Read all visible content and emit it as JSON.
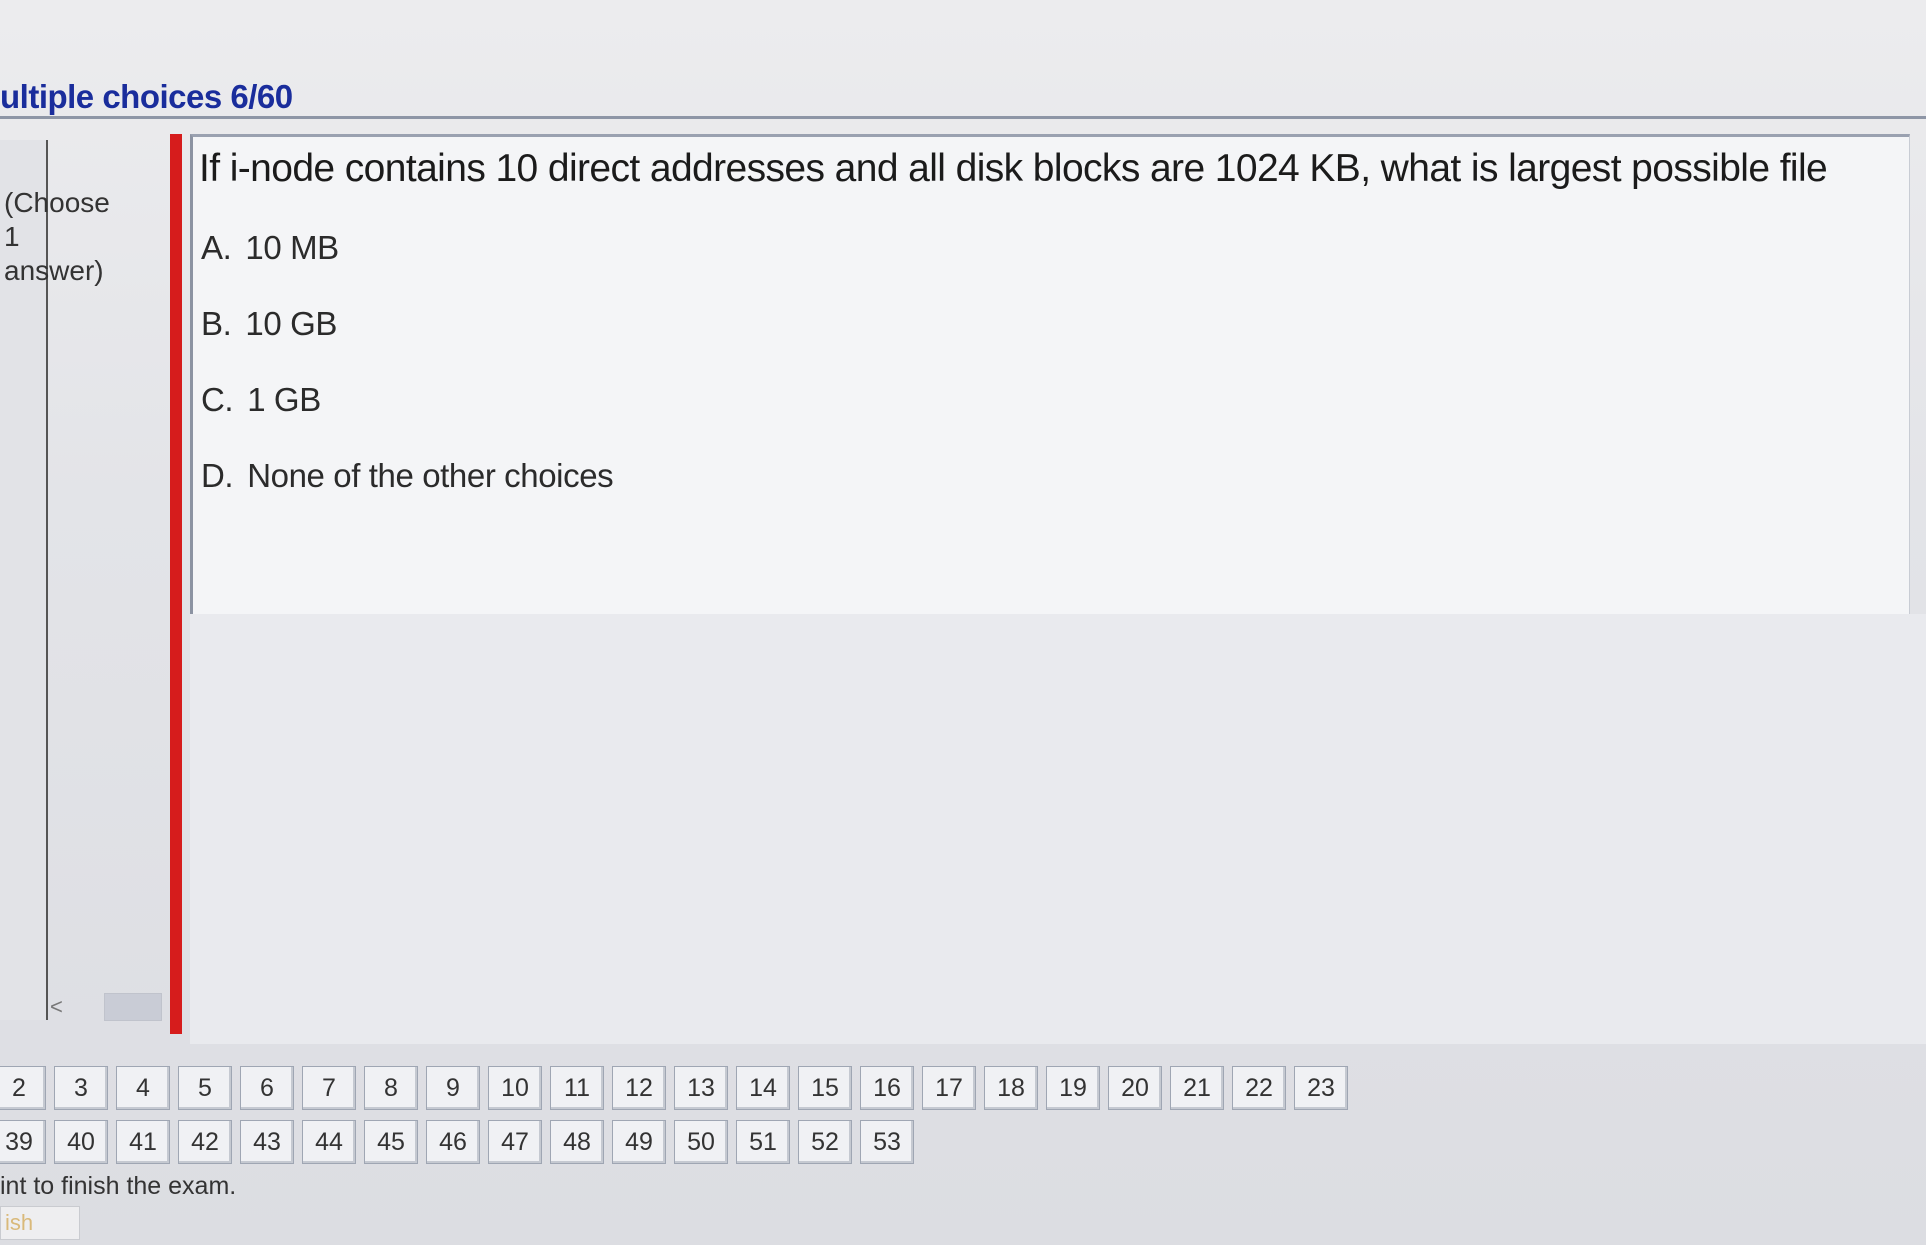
{
  "section_title": "ultiple choices 6/60",
  "hint": [
    "(Choose",
    "1",
    "answer)"
  ],
  "scroll": {
    "left_arrow": "<",
    "right_arrow": ">"
  },
  "question": {
    "text": "If i-node contains 10 direct addresses and all disk blocks are 1024 KB, what is largest possible file",
    "choices": [
      {
        "letter": "A.",
        "label": "10 MB"
      },
      {
        "letter": "B.",
        "label": "10 GB"
      },
      {
        "letter": "C.",
        "label": "1 GB"
      },
      {
        "letter": "D.",
        "label": "None of  the other choices"
      }
    ]
  },
  "nav": {
    "row1": [
      "2",
      "3",
      "4",
      "5",
      "6",
      "7",
      "8",
      "9",
      "10",
      "11",
      "12",
      "13",
      "14",
      "15",
      "16",
      "17",
      "18",
      "19",
      "20",
      "21",
      "22",
      "23"
    ],
    "row2": [
      "39",
      "40",
      "41",
      "42",
      "43",
      "44",
      "45",
      "46",
      "47",
      "48",
      "49",
      "50",
      "51",
      "52",
      "53"
    ]
  },
  "finish_message": "int to finish the exam.",
  "finish_button": "ish"
}
